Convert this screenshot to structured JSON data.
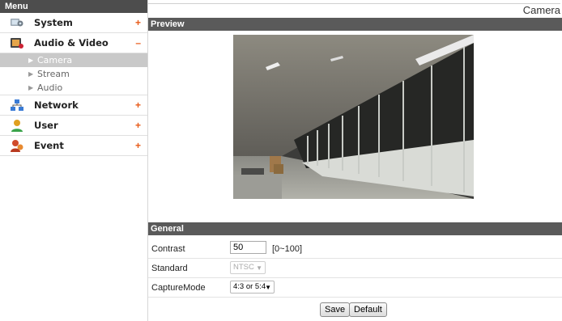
{
  "menu": {
    "title": "Menu",
    "items": [
      {
        "label": "System",
        "toggle": "+"
      },
      {
        "label": "Audio & Video",
        "toggle": "–"
      },
      {
        "label": "Network",
        "toggle": "+"
      },
      {
        "label": "User",
        "toggle": "+"
      },
      {
        "label": "Event",
        "toggle": "+"
      }
    ],
    "sub_items": [
      {
        "label": "Camera",
        "active": true
      },
      {
        "label": "Stream"
      },
      {
        "label": "Audio"
      }
    ]
  },
  "page": {
    "title": "Camera",
    "preview_title": "Preview",
    "general_title": "General"
  },
  "general": {
    "contrast_label": "Contrast",
    "contrast_value": "50",
    "contrast_range": "[0~100]",
    "standard_label": "Standard",
    "standard_value": "NTSC",
    "capture_label": "CaptureMode",
    "capture_value": "4:3 or 5:4",
    "save_label": "Save",
    "default_label": "Default"
  },
  "colors": {
    "section_bar": "#5a5a5a",
    "menu_header": "#4d4d4d",
    "toggle": "#e85a18"
  }
}
